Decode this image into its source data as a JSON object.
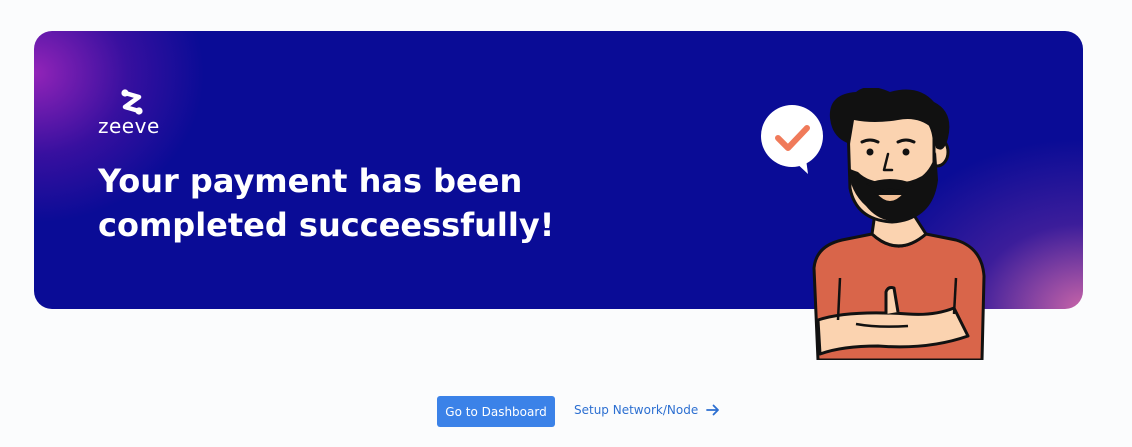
{
  "brand": {
    "name": "zeeve",
    "logo_icon": "zeeve-logo-icon"
  },
  "banner": {
    "headline_line1": "Your payment has been",
    "headline_line2": "completed succeessfully!",
    "illustration": "man-thumbs-up-with-checkmark-bubble"
  },
  "actions": {
    "dashboard_label": "Go to Dashboard",
    "setup_label": "Setup Network/Node",
    "setup_icon": "arrow-right-icon"
  },
  "colors": {
    "banner_bg": "#0a0c96",
    "button_bg": "#3b82e8",
    "link": "#2c6fd1",
    "check": "#f07a5a",
    "shirt": "#d9654a"
  }
}
